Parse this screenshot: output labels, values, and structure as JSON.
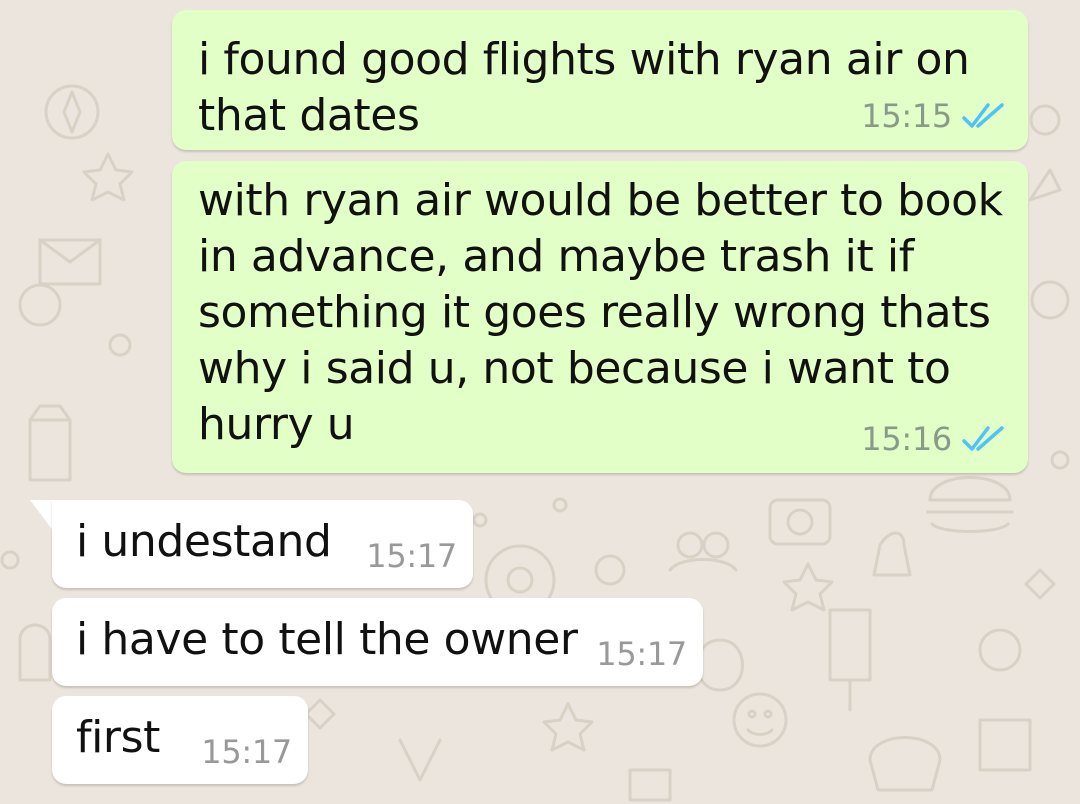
{
  "colors": {
    "chat_background": "#ece5dd",
    "outgoing_bubble": "#e2ffc7",
    "incoming_bubble": "#ffffff",
    "read_receipt": "#4fc3f7"
  },
  "messages": [
    {
      "direction": "outgoing",
      "text": "i found good flights with ryan air on\nthat dates",
      "time": "15:15",
      "status_icon": "double-check-read-icon"
    },
    {
      "direction": "outgoing",
      "text": "with ryan air would be better to book\nin advance, and maybe trash it if\nsomething it goes really wrong thats\nwhy i said u, not because i want to\nhurry u",
      "time": "15:16",
      "status_icon": "double-check-read-icon"
    },
    {
      "direction": "incoming",
      "text": "i undestand",
      "time": "15:17"
    },
    {
      "direction": "incoming",
      "text": "i have to tell the owner",
      "time": "15:17"
    },
    {
      "direction": "incoming",
      "text": "first",
      "time": "15:17"
    }
  ]
}
